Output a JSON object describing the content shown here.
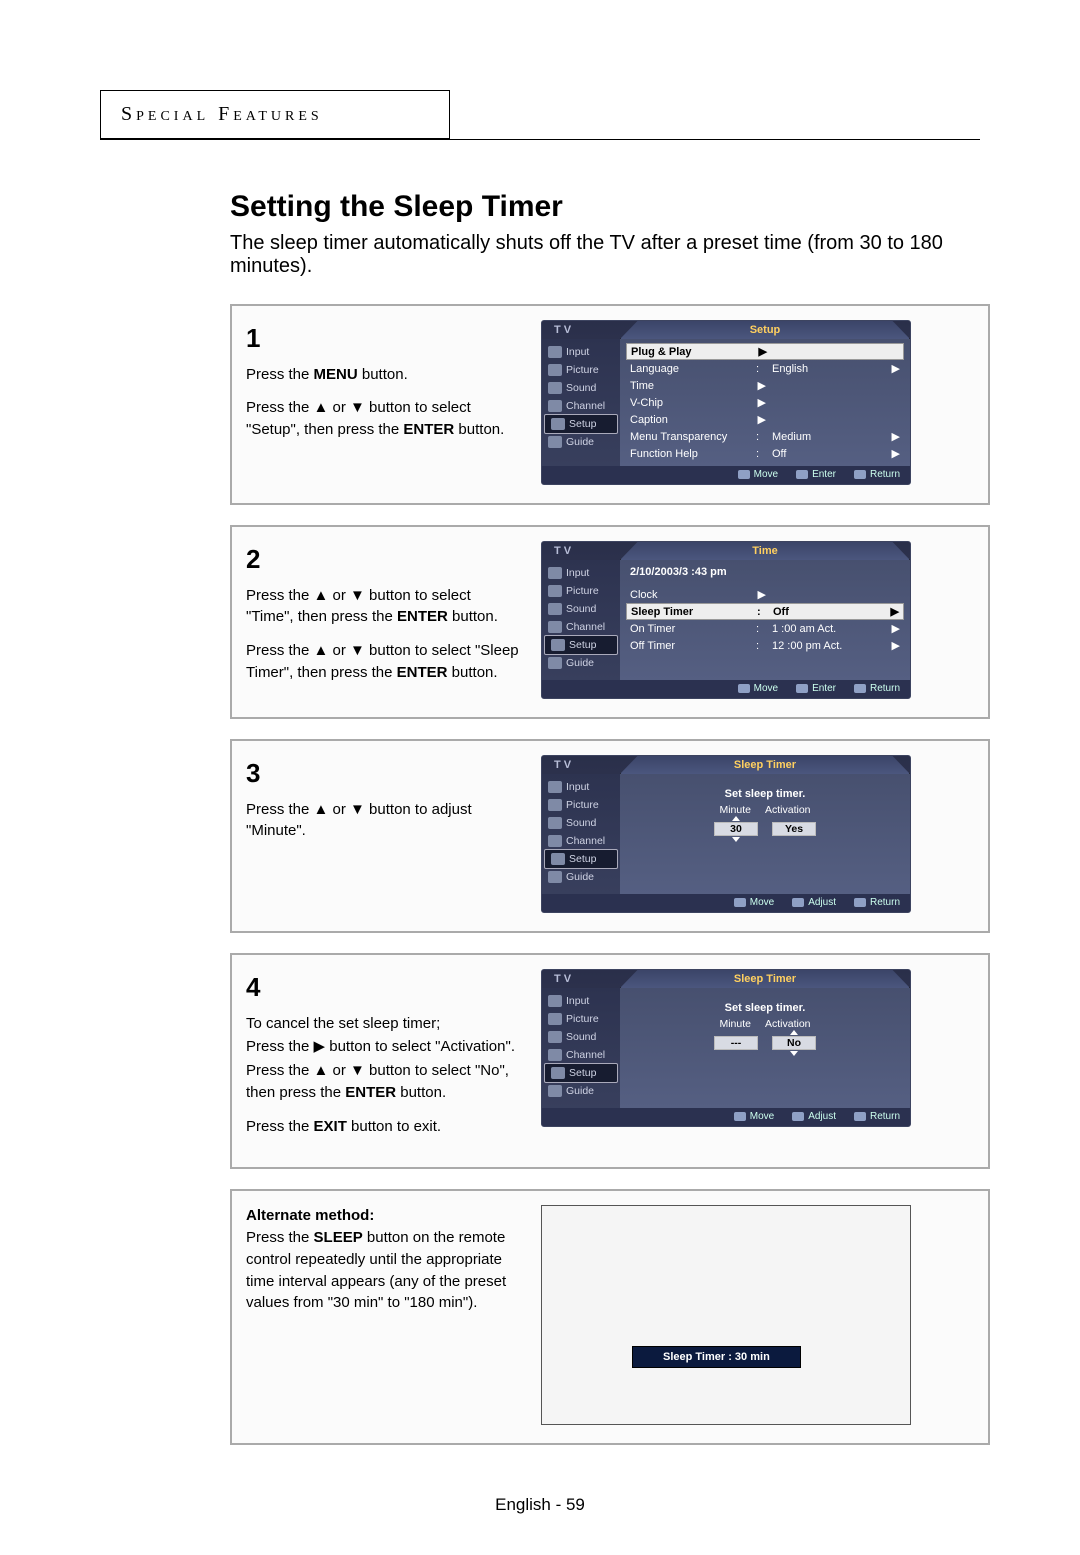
{
  "section": "Special Features",
  "title": "Setting the Sleep Timer",
  "intro": "The sleep timer automatically shuts off the TV after a preset time (from 30 to 180 minutes).",
  "sidebar": {
    "items": [
      {
        "label": "Input"
      },
      {
        "label": "Picture"
      },
      {
        "label": "Sound"
      },
      {
        "label": "Channel"
      },
      {
        "label": "Setup"
      },
      {
        "label": "Guide"
      }
    ]
  },
  "steps": {
    "s1": {
      "num": "1",
      "p1a": "Press the ",
      "p1b": "MENU",
      "p1c": " button.",
      "p2a": "Press the  ▲ or ▼ button to select \"Setup\", then press the ",
      "p2b": "ENTER",
      "p2c": " button.",
      "menuTitle": "Setup",
      "rows": [
        {
          "label": "Plug & Play",
          "val": "",
          "hi": true
        },
        {
          "label": "Language",
          "val": "English"
        },
        {
          "label": "Time",
          "val": ""
        },
        {
          "label": "V-Chip",
          "val": ""
        },
        {
          "label": "Caption",
          "val": ""
        },
        {
          "label": "Menu Transparency",
          "val": "Medium"
        },
        {
          "label": "Function Help",
          "val": "Off"
        }
      ],
      "foot": [
        "Move",
        "Enter",
        "Return"
      ]
    },
    "s2": {
      "num": "2",
      "p1a": "Press the  ▲ or ▼ button to select \"Time\", then press the ",
      "p1b": "ENTER",
      "p1c": " button.",
      "p2a": "Press the ▲ or ▼ button to select \"Sleep Timer\", then press the ",
      "p2b": "ENTER",
      "p2c": " button.",
      "menuTitle": "Time",
      "datetime": "2/10/2003/3 :43  pm",
      "rows": [
        {
          "label": "Clock",
          "val": ""
        },
        {
          "label": "Sleep Timer",
          "val": "Off",
          "hi": true
        },
        {
          "label": "On Timer",
          "val": "1 :00  am Act."
        },
        {
          "label": "Off Timer",
          "val": "12 :00  pm Act."
        }
      ],
      "foot": [
        "Move",
        "Enter",
        "Return"
      ]
    },
    "s3": {
      "num": "3",
      "p1": "Press the ▲ or ▼ button to adjust \"Minute\".",
      "menuTitle": "Sleep Timer",
      "headline": "Set sleep timer.",
      "col1": "Minute",
      "col2": "Activation",
      "val1": "30",
      "val2": "Yes",
      "foot": [
        "Move",
        "Adjust",
        "Return"
      ]
    },
    "s4": {
      "num": "4",
      "p1": "To cancel the set sleep timer;",
      "p2": "Press the ▶ button to select \"Activation\".",
      "p3a": "Press the ▲ or ▼ button to select \"No\", then press the ",
      "p3b": "ENTER",
      "p3c": " button.",
      "p4a": "Press the ",
      "p4b": "EXIT",
      "p4c": " button to exit.",
      "menuTitle": "Sleep Timer",
      "headline": "Set sleep timer.",
      "col1": "Minute",
      "col2": "Activation",
      "val1": "---",
      "val2": "No",
      "foot": [
        "Move",
        "Adjust",
        "Return"
      ]
    },
    "s5": {
      "altHead": "Alternate method:",
      "p1a": "Press the ",
      "p1b": "SLEEP",
      "p1c": " button on the remote control repeatedly until the appropriate time interval appears (any of the preset values from \"30 min\" to \"180 min\").",
      "banner": "Sleep Timer : 30 min"
    }
  },
  "tvLabel": "T V",
  "footer": "English - 59"
}
